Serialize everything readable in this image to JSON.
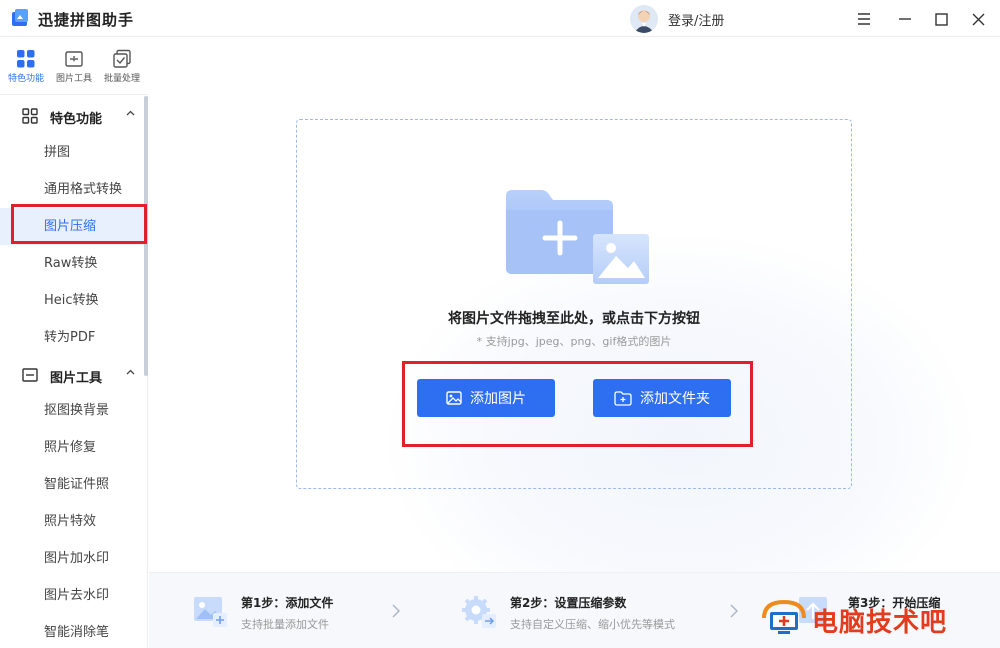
{
  "app": {
    "title": "迅捷拼图助手",
    "login_label": "登录/注册"
  },
  "top_tabs": [
    {
      "label": "特色功能"
    },
    {
      "label": "图片工具"
    },
    {
      "label": "批量处理"
    }
  ],
  "sidebar": {
    "group1": {
      "label": "特色功能",
      "items": [
        "拼图",
        "通用格式转换",
        "图片压缩",
        "Raw转换",
        "Heic转换",
        "转为PDF"
      ]
    },
    "group2": {
      "label": "图片工具",
      "items": [
        "抠图换背景",
        "照片修复",
        "智能证件照",
        "照片特效",
        "图片加水印",
        "图片去水印",
        "智能消除笔"
      ]
    },
    "active_item": "图片压缩"
  },
  "dropzone": {
    "title": "将图片文件拖拽至此处，或点击下方按钮",
    "subtitle": "* 支持jpg、jpeg、png、gif格式的图片",
    "add_image_label": "添加图片",
    "add_folder_label": "添加文件夹"
  },
  "steps": [
    {
      "title": "第1步：添加文件",
      "desc": "支持批量添加文件"
    },
    {
      "title": "第2步：设置压缩参数",
      "desc": "支持自定义压缩、缩小优先等模式"
    },
    {
      "title": "第3步：开始压缩",
      "desc": ""
    }
  ],
  "watermark": {
    "text": "电脑技术吧"
  },
  "colors": {
    "accent": "#2e6ff2",
    "highlight_box": "#e0202c",
    "watermark": "#e33b1e"
  }
}
